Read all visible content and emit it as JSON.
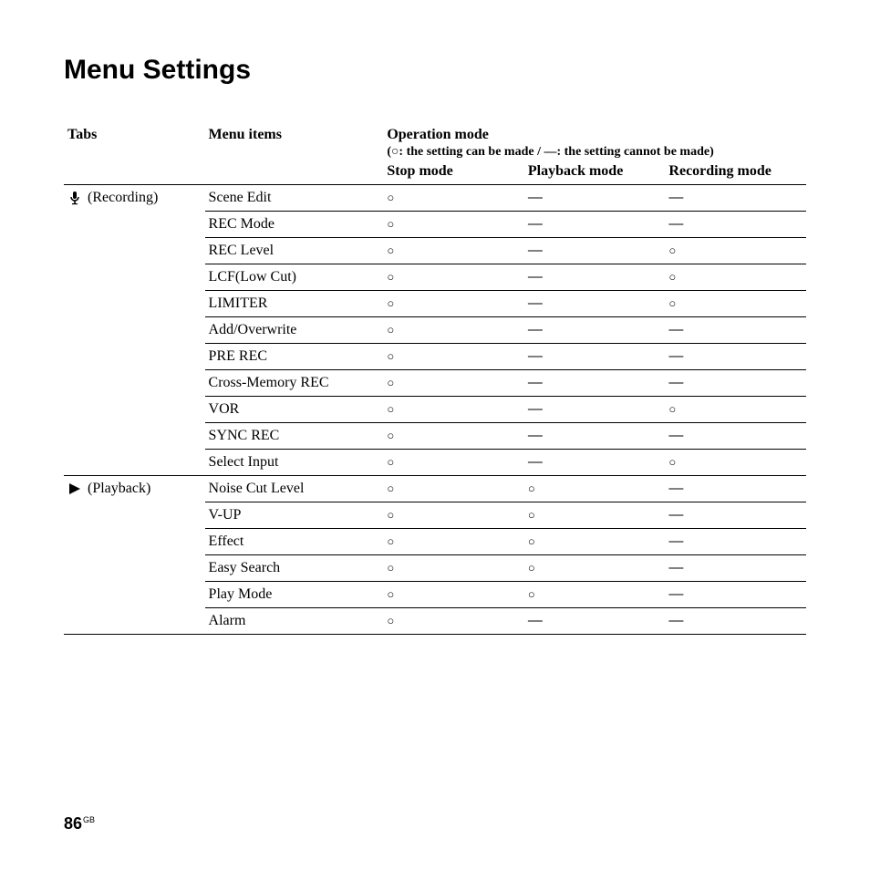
{
  "title": "Menu Settings",
  "headers": {
    "tabs": "Tabs",
    "items": "Menu items",
    "opmode": "Operation mode",
    "legend": "(○: the setting can be made / —: the setting cannot be made)",
    "stop": "Stop mode",
    "playback": "Playback mode",
    "recording": "Recording mode"
  },
  "tabs": [
    {
      "icon": "mic-icon",
      "label": "(Recording)"
    },
    {
      "icon": "play-icon",
      "label": "(Playback)"
    }
  ],
  "rows": [
    {
      "tab": 0,
      "item": "Scene Edit",
      "stop": "o",
      "play": "-",
      "rec": "-"
    },
    {
      "tab": 0,
      "item": "REC Mode",
      "stop": "o",
      "play": "-",
      "rec": "-"
    },
    {
      "tab": 0,
      "item": "REC Level",
      "stop": "o",
      "play": "-",
      "rec": "o"
    },
    {
      "tab": 0,
      "item": "LCF(Low Cut)",
      "stop": "o",
      "play": "-",
      "rec": "o"
    },
    {
      "tab": 0,
      "item": "LIMITER",
      "stop": "o",
      "play": "-",
      "rec": "o"
    },
    {
      "tab": 0,
      "item": "Add/Overwrite",
      "stop": "o",
      "play": "-",
      "rec": "-"
    },
    {
      "tab": 0,
      "item": "PRE REC",
      "stop": "o",
      "play": "-",
      "rec": "-"
    },
    {
      "tab": 0,
      "item": "Cross-Memory REC",
      "stop": "o",
      "play": "-",
      "rec": "-"
    },
    {
      "tab": 0,
      "item": "VOR",
      "stop": "o",
      "play": "-",
      "rec": "o"
    },
    {
      "tab": 0,
      "item": "SYNC REC",
      "stop": "o",
      "play": "-",
      "rec": "-"
    },
    {
      "tab": 0,
      "item": "Select Input",
      "stop": "o",
      "play": "-",
      "rec": "o",
      "end": true
    },
    {
      "tab": 1,
      "item": "Noise Cut Level",
      "stop": "o",
      "play": "o",
      "rec": "-"
    },
    {
      "tab": 1,
      "item": "V-UP",
      "stop": "o",
      "play": "o",
      "rec": "-"
    },
    {
      "tab": 1,
      "item": "Effect",
      "stop": "o",
      "play": "o",
      "rec": "-"
    },
    {
      "tab": 1,
      "item": "Easy Search",
      "stop": "o",
      "play": "o",
      "rec": "-"
    },
    {
      "tab": 1,
      "item": "Play Mode",
      "stop": "o",
      "play": "o",
      "rec": "-"
    },
    {
      "tab": 1,
      "item": "Alarm",
      "stop": "o",
      "play": "-",
      "rec": "-",
      "end": true
    }
  ],
  "page": {
    "num": "86",
    "region": "GB"
  }
}
